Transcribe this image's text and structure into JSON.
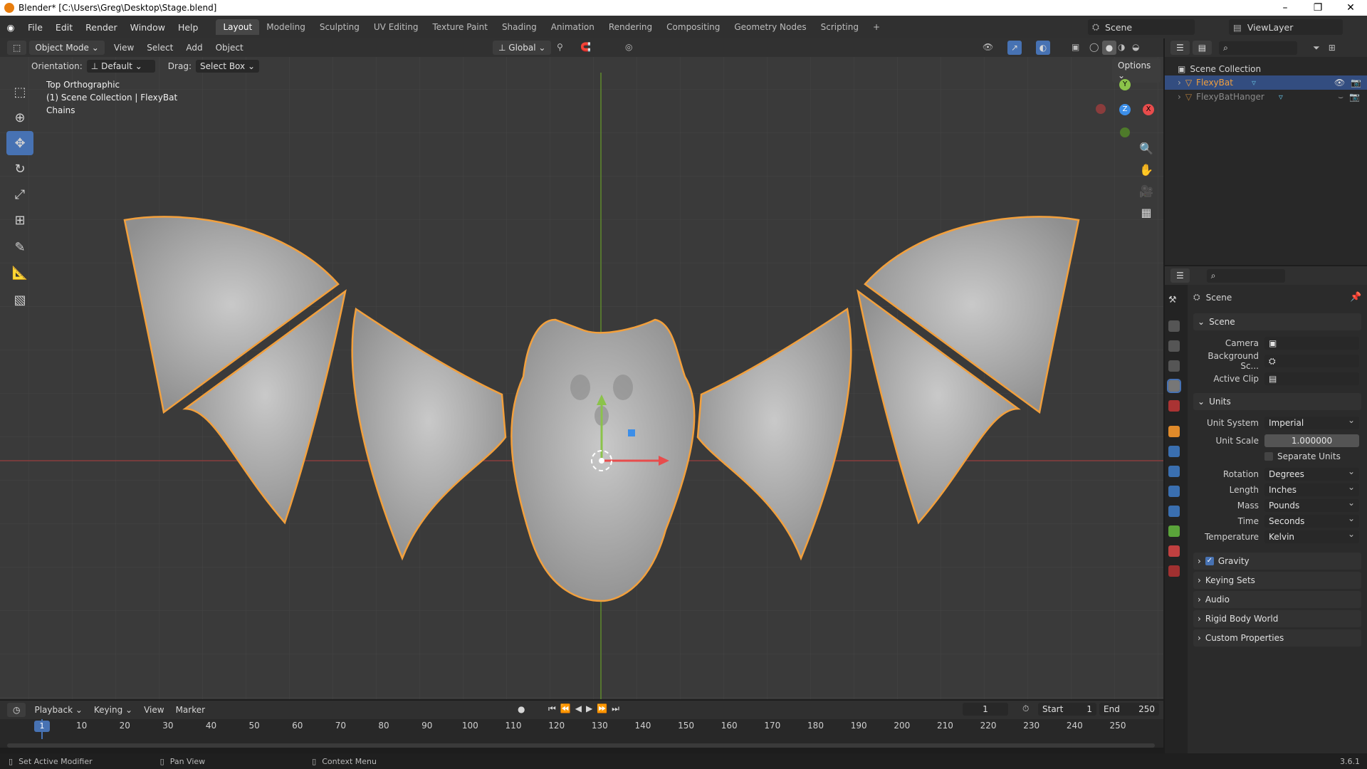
{
  "window": {
    "title": "Blender* [C:\\Users\\Greg\\Desktop\\Stage.blend]"
  },
  "menus": [
    "File",
    "Edit",
    "Render",
    "Window",
    "Help"
  ],
  "workspaces": [
    "Layout",
    "Modeling",
    "Sculpting",
    "UV Editing",
    "Texture Paint",
    "Shading",
    "Animation",
    "Rendering",
    "Compositing",
    "Geometry Nodes",
    "Scripting"
  ],
  "active_workspace": "Layout",
  "scene_selector": "Scene",
  "view_layer": "ViewLayer",
  "viewport_header": {
    "mode": "Object Mode",
    "menus": [
      "View",
      "Select",
      "Add",
      "Object"
    ],
    "transform_orientation": "Global",
    "orientation_label": "Orientation:",
    "orientation_value": "Default",
    "drag_label": "Drag:",
    "drag_value": "Select Box",
    "options": "Options"
  },
  "viewport_info": {
    "line1": "Top Orthographic",
    "line2": "(1) Scene Collection | FlexyBat",
    "line3": "Chains"
  },
  "gizmo": {
    "x": "X",
    "y": "Y",
    "z": "Z"
  },
  "outliner": {
    "root": "Scene Collection",
    "items": [
      {
        "name": "FlexyBat",
        "selected": true
      },
      {
        "name": "FlexyBatHanger",
        "selected": false
      }
    ]
  },
  "properties": {
    "context": "Scene",
    "scene_section": "Scene",
    "camera_label": "Camera",
    "background_label": "Background Sc...",
    "active_clip_label": "Active Clip",
    "units_section": "Units",
    "unit_system_label": "Unit System",
    "unit_system": "Imperial",
    "unit_scale_label": "Unit Scale",
    "unit_scale": "1.000000",
    "separate_units": "Separate Units",
    "rotation_label": "Rotation",
    "rotation": "Degrees",
    "length_label": "Length",
    "length": "Inches",
    "mass_label": "Mass",
    "mass": "Pounds",
    "time_label": "Time",
    "time": "Seconds",
    "temperature_label": "Temperature",
    "temperature": "Kelvin",
    "collapsed_sections": [
      "Gravity",
      "Keying Sets",
      "Audio",
      "Rigid Body World",
      "Custom Properties"
    ]
  },
  "timeline": {
    "menus": [
      "Playback",
      "Keying",
      "View",
      "Marker"
    ],
    "current_frame": "1",
    "start_label": "Start",
    "start": "1",
    "end_label": "End",
    "end": "250",
    "ticks": [
      "1",
      "10",
      "20",
      "30",
      "40",
      "50",
      "60",
      "70",
      "80",
      "90",
      "100",
      "110",
      "120",
      "130",
      "140",
      "150",
      "160",
      "170",
      "180",
      "190",
      "200",
      "210",
      "220",
      "230",
      "240",
      "250"
    ]
  },
  "statusbar": {
    "hint1": "Set Active Modifier",
    "hint2": "Pan View",
    "hint3": "Context Menu",
    "version": "3.6.1"
  },
  "colors": {
    "accent": "#4772b3",
    "selection_outline": "#f2a03d",
    "x_axis": "#e84c4c",
    "y_axis": "#8bc34a",
    "z_axis": "#3c8ee8"
  }
}
